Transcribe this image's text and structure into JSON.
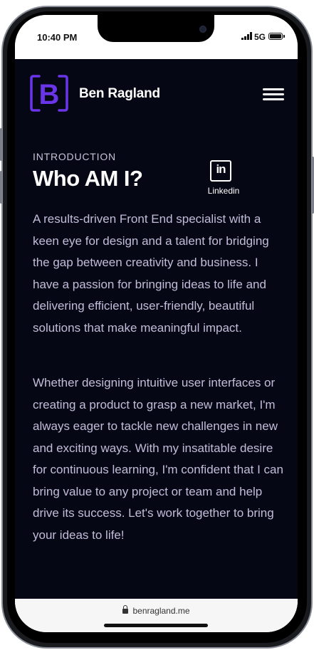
{
  "status_bar": {
    "time": "10:40 PM",
    "network": "5G"
  },
  "header": {
    "logo_letter": "B",
    "brand_name": "Ben Ragland",
    "menu_icon": "hamburger-menu-icon"
  },
  "intro": {
    "eyebrow": "INTRODUCTION",
    "title": "Who AM I?",
    "linkedin_glyph": "in",
    "linkedin_label": "Linkedin",
    "paragraphs": [
      "A results-driven Front End specialist with a keen eye for design and a talent for bridging the gap between creativity and business. I have a passion for bringing ideas to life and delivering efficient, user-friendly, beautiful solutions that make meaningful impact.",
      "Whether designing intuitive user interfaces or creating a product to grasp a new market, I'm always eager to tackle new challenges in new and exciting ways. With my insatitable desire for continuous learning, I'm confident that I can bring value to any project or team and help drive its success. Let's work together to bring your ideas to life!"
    ]
  },
  "browser": {
    "url": "benragland.me",
    "lock_icon": "lock-icon"
  },
  "colors": {
    "background": "#050814",
    "accent": "#6a35e8",
    "body_text": "#c3bbd9"
  }
}
